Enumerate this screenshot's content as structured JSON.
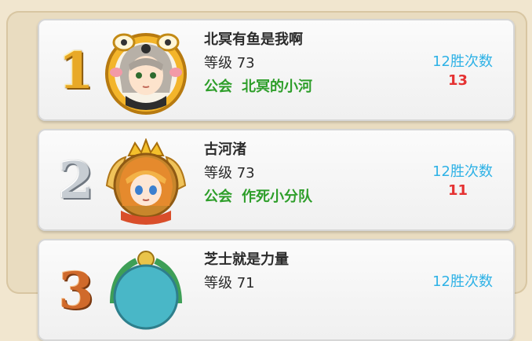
{
  "leaderboard": {
    "entries": [
      {
        "rank": "1",
        "name": "北冥有鱼是我啊",
        "level_label": "等级 73",
        "guild_prefix": "公会",
        "guild_name": "北冥的小河",
        "wins_label": "12胜次数",
        "wins_count": "13"
      },
      {
        "rank": "2",
        "name": "古河渚",
        "level_label": "等级 73",
        "guild_prefix": "公会",
        "guild_name": "作死小分队",
        "wins_label": "12胜次数",
        "wins_count": "11"
      },
      {
        "rank": "3",
        "name": "芝士就是力量",
        "level_label": "等级 71",
        "wins_label": "12胜次数"
      }
    ]
  },
  "colors": {
    "gold": "#e8a927",
    "silver": "#c7cdd3",
    "bronze": "#d06a2b",
    "guild_text": "#2e9e2a",
    "wins_label": "#2fb2e6",
    "wins_count": "#e53232"
  },
  "icons": [
    "avatar-portrait-icon",
    "crown-frame-icon",
    "laurel-frame-icon"
  ]
}
